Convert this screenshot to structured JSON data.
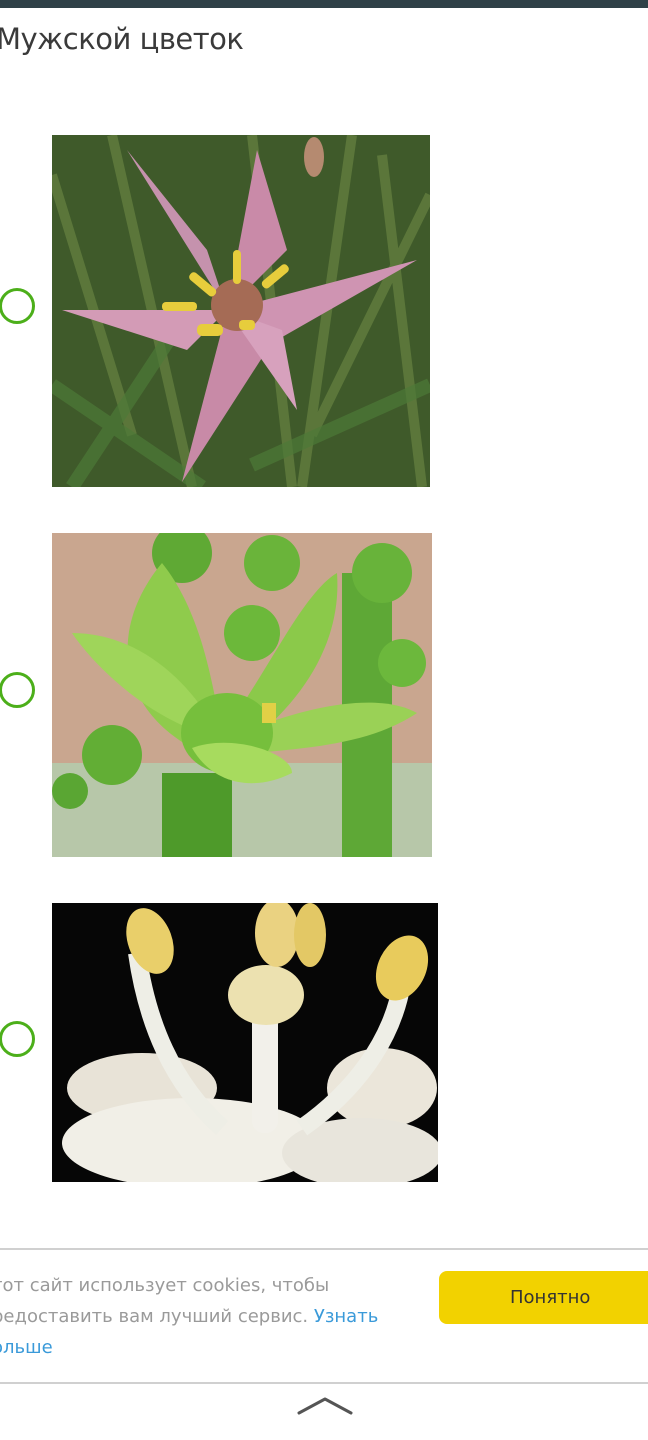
{
  "question": {
    "title": "Мужской цветок"
  },
  "options": [
    {
      "image": "pink-star-flower-photo",
      "selected": false
    },
    {
      "image": "green-flower-buds-photo",
      "selected": false
    },
    {
      "image": "white-stamens-flower-photo",
      "selected": false
    }
  ],
  "cookie_banner": {
    "text": "тот сайт использует cookies, чтобы редоставить вам лучший сервис.",
    "link_text": "Узнать ольше",
    "button_label": "Понятно"
  },
  "icons": {
    "radio": "radio-circle-icon",
    "scroll_up": "chevron-up-icon"
  },
  "colors": {
    "top_bar": "#2f4147",
    "radio_border": "#4caf1a",
    "button": "#f2d200",
    "link": "#3a9ad9"
  }
}
